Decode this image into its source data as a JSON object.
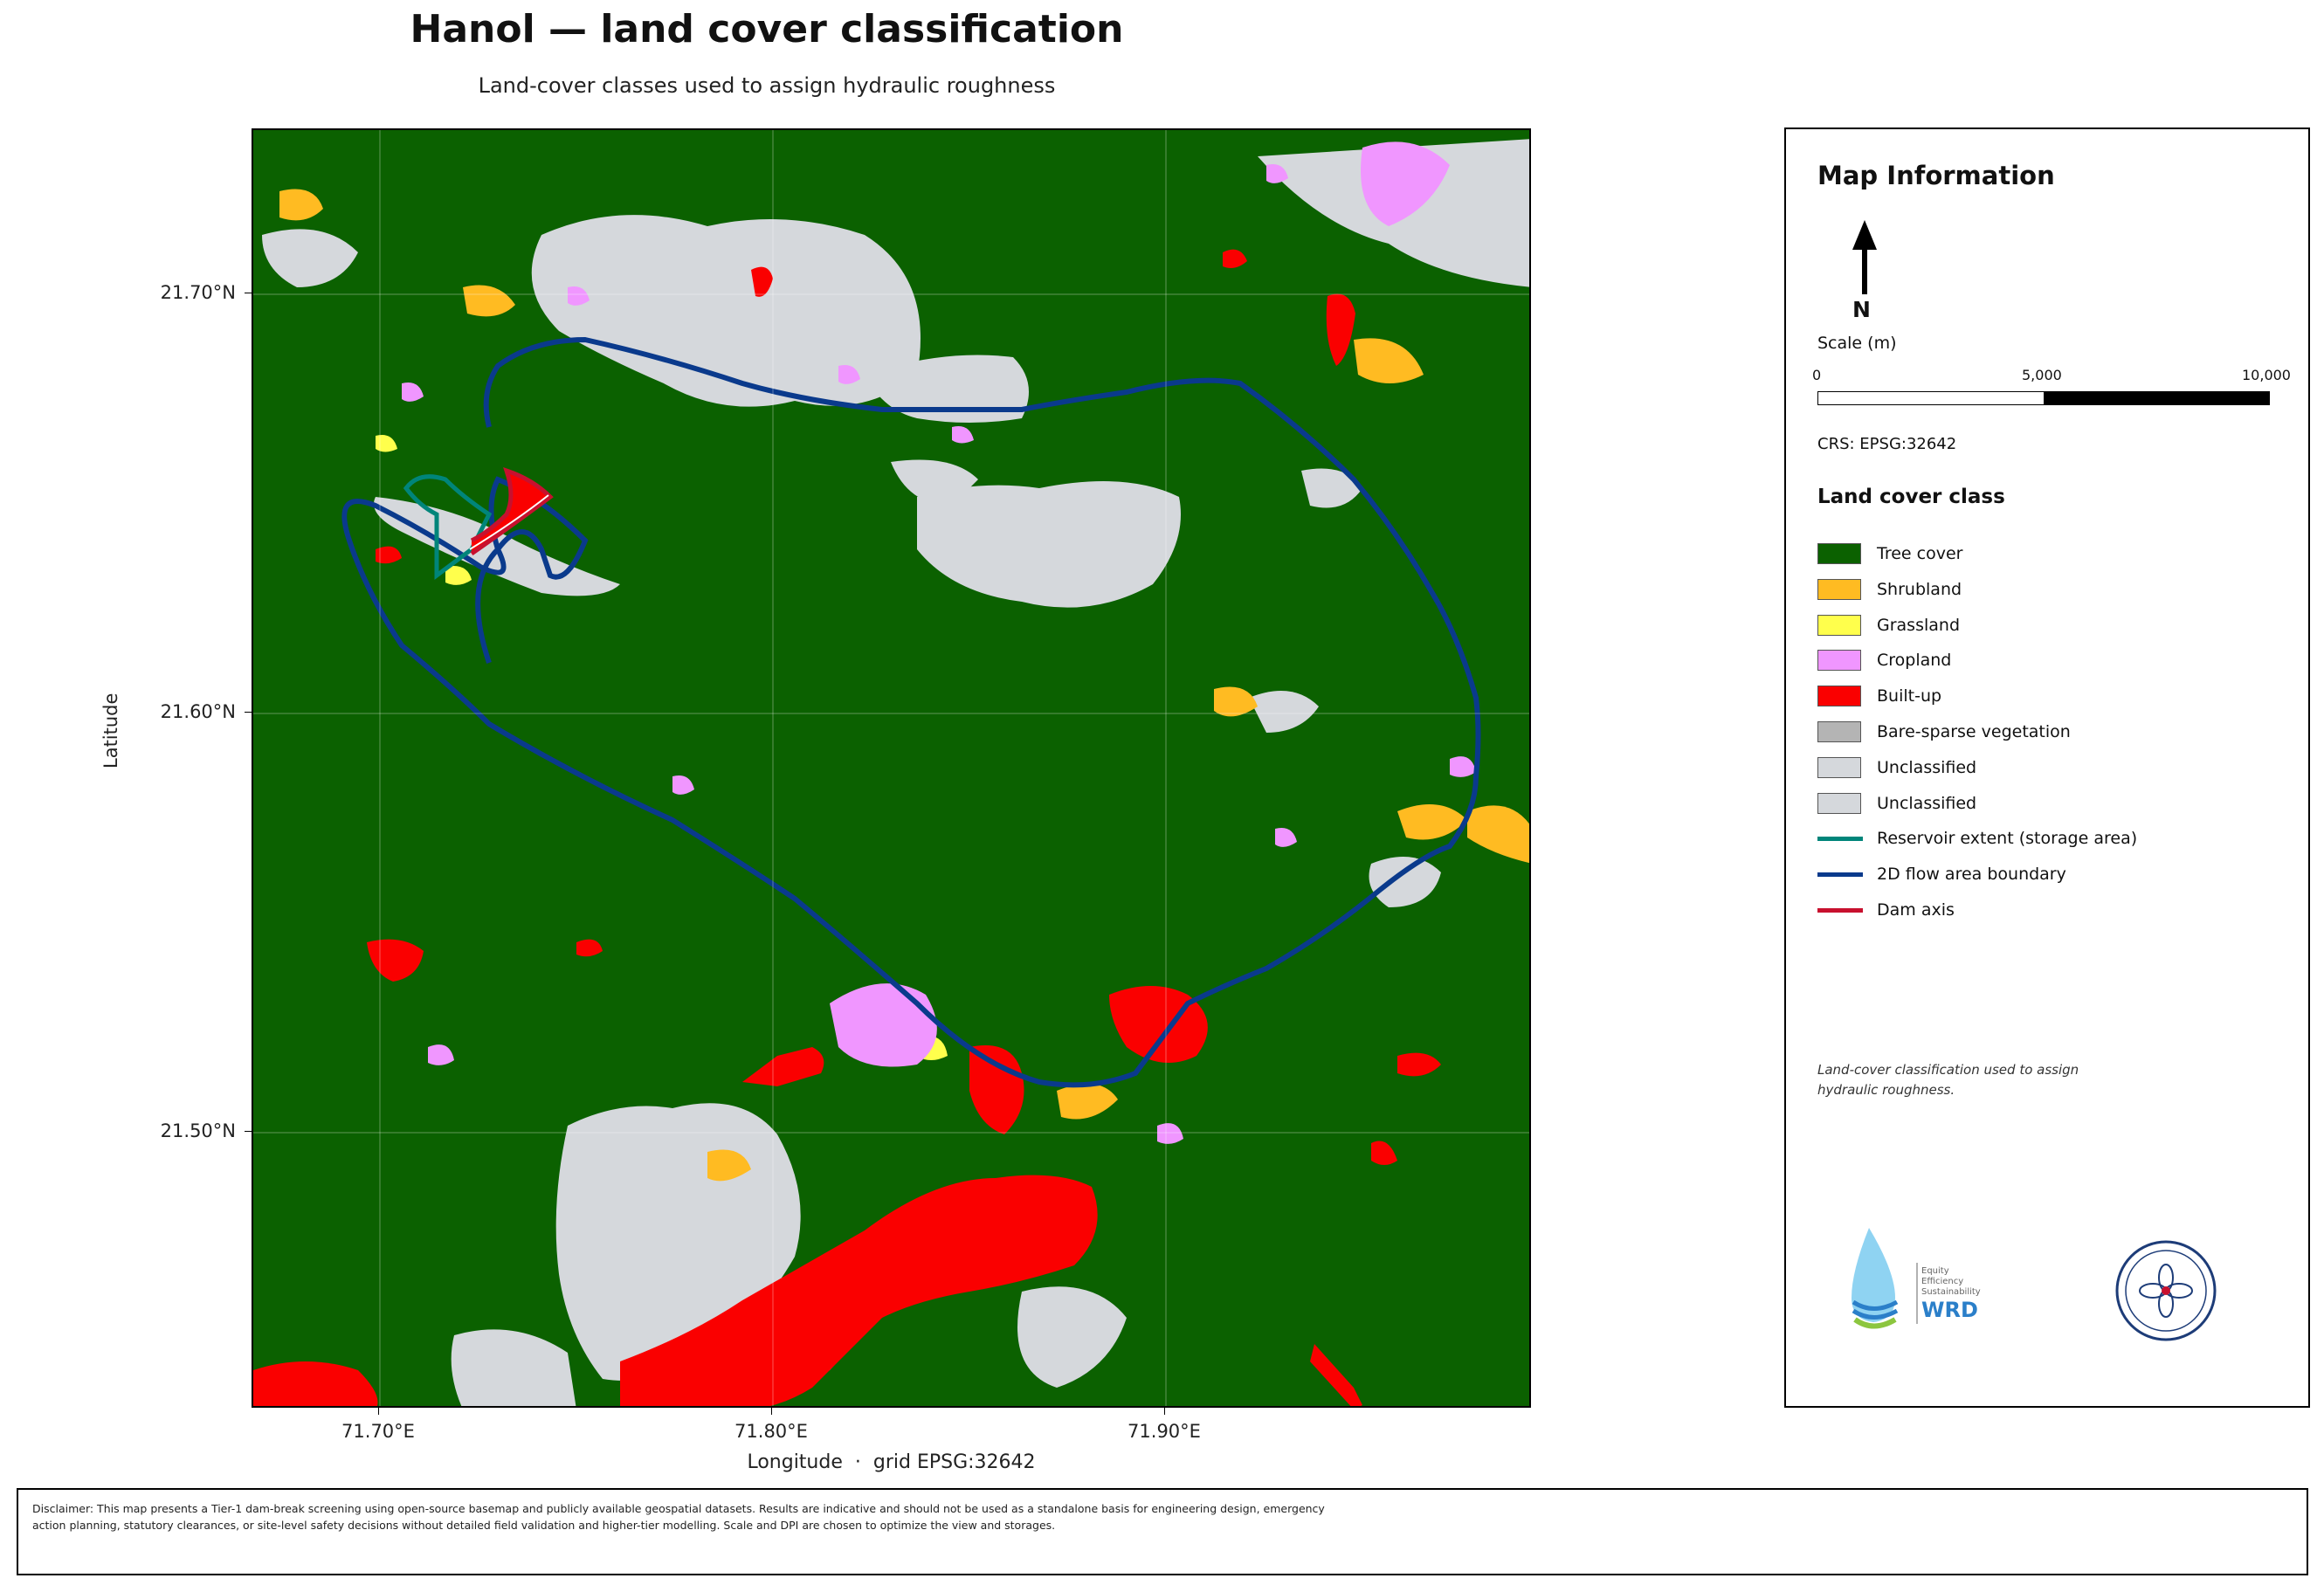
{
  "title": "Hanol — land cover classification",
  "subtitle": "Land-cover classes used to assign hydraulic roughness",
  "axes": {
    "y_label": "Latitude",
    "x_label": "Longitude",
    "x_label_suffix": "grid EPSG:32642",
    "y_ticks": [
      "21.70°N",
      "21.60°N",
      "21.50°N"
    ],
    "x_ticks": [
      "71.70°E",
      "71.80°E",
      "71.90°E"
    ]
  },
  "info_panel": {
    "title": "Map Information",
    "north_label": "N",
    "scale_title": "Scale (m)",
    "scale_labels": [
      "0",
      "5,000",
      "10,000"
    ],
    "crs": "CRS: EPSG:32642",
    "legend_title": "Land cover class",
    "legend": [
      {
        "label": "Tree cover",
        "kind": "patch",
        "color": "#0b6100"
      },
      {
        "label": "Shrubland",
        "kind": "patch",
        "color": "#ffbb22"
      },
      {
        "label": "Grassland",
        "kind": "patch",
        "color": "#ffff4c"
      },
      {
        "label": "Cropland",
        "kind": "patch",
        "color": "#f096ff"
      },
      {
        "label": "Built-up",
        "kind": "patch",
        "color": "#fa0000"
      },
      {
        "label": "Bare-sparse vegetation",
        "kind": "patch",
        "color": "#b4b4b4"
      },
      {
        "label": "Unclassified",
        "kind": "patch",
        "color": "#d5d8dc"
      },
      {
        "label": "Unclassified",
        "kind": "patch",
        "color": "#d5d8dc"
      },
      {
        "label": "Reservoir extent (storage area)",
        "kind": "line",
        "color": "#00857a"
      },
      {
        "label": "2D flow area boundary",
        "kind": "line",
        "color": "#0a3a8c"
      },
      {
        "label": "Dam axis",
        "kind": "line",
        "color": "#c8102e"
      }
    ],
    "note": "Land-cover classification used to assign hydraulic roughness.",
    "logo_text": [
      "Equity",
      "Efficiency",
      "Sustainability",
      "WRD"
    ]
  },
  "disclaimer": "Disclaimer: This map presents a Tier-1 dam-break screening using open-source basemap and publicly available geospatial datasets. Results are indicative and should not be used as a standalone basis for engineering design, emergency action planning, statutory clearances, or site-level safety decisions without detailed field validation and higher-tier modelling. Scale and DPI are chosen to optimize the view and storages."
}
